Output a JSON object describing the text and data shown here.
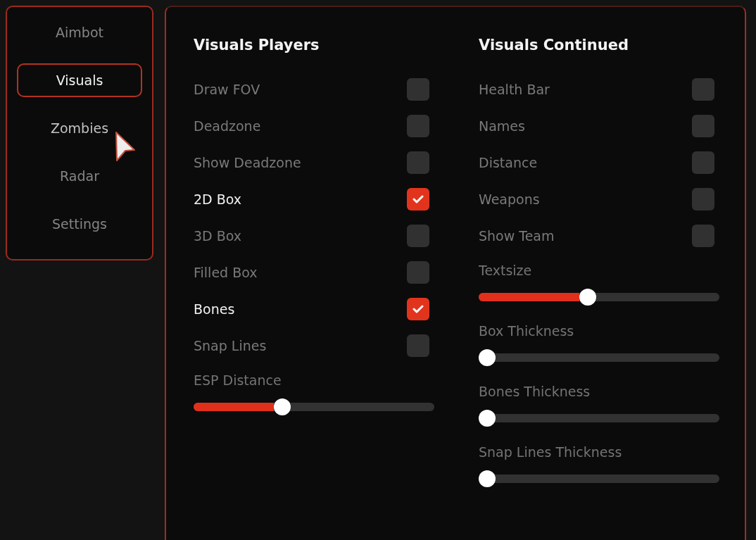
{
  "sidebar": {
    "items": [
      {
        "label": "Aimbot",
        "selected": false,
        "hovered": false
      },
      {
        "label": "Visuals",
        "selected": true,
        "hovered": false
      },
      {
        "label": "Zombies",
        "selected": false,
        "hovered": true
      },
      {
        "label": "Radar",
        "selected": false,
        "hovered": false
      },
      {
        "label": "Settings",
        "selected": false,
        "hovered": false
      }
    ]
  },
  "panel": {
    "columns": [
      {
        "title": "Visuals Players",
        "controls": [
          {
            "kind": "checkbox",
            "label": "Draw FOV",
            "checked": false
          },
          {
            "kind": "checkbox",
            "label": "Deadzone",
            "checked": false
          },
          {
            "kind": "checkbox",
            "label": "Show Deadzone",
            "checked": false
          },
          {
            "kind": "checkbox",
            "label": "2D Box",
            "checked": true
          },
          {
            "kind": "checkbox",
            "label": "3D Box",
            "checked": false
          },
          {
            "kind": "checkbox",
            "label": "Filled Box",
            "checked": false
          },
          {
            "kind": "checkbox",
            "label": "Bones",
            "checked": true
          },
          {
            "kind": "checkbox",
            "label": "Snap Lines",
            "checked": false
          },
          {
            "kind": "slider",
            "label": "ESP Distance",
            "level": 0.36
          }
        ]
      },
      {
        "title": "Visuals Continued",
        "controls": [
          {
            "kind": "checkbox",
            "label": "Health Bar",
            "checked": false
          },
          {
            "kind": "checkbox",
            "label": "Names",
            "checked": false
          },
          {
            "kind": "checkbox",
            "label": "Distance",
            "checked": false
          },
          {
            "kind": "checkbox",
            "label": "Weapons",
            "checked": false
          },
          {
            "kind": "checkbox",
            "label": "Show Team",
            "checked": false
          },
          {
            "kind": "slider",
            "label": "Textsize",
            "level": 0.45
          },
          {
            "kind": "slider",
            "label": "Box Thickness",
            "level": 0
          },
          {
            "kind": "slider",
            "label": "Bones Thickness",
            "level": 0
          },
          {
            "kind": "slider",
            "label": "Snap Lines Thickness",
            "level": 0
          }
        ]
      }
    ]
  }
}
